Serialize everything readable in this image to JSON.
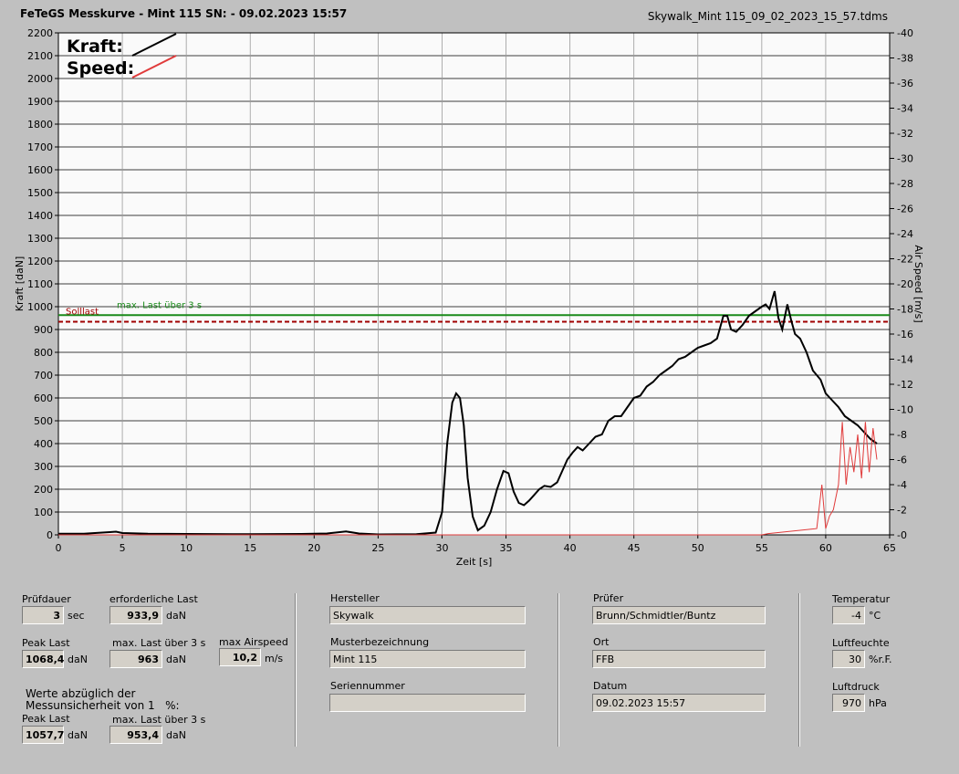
{
  "header": {
    "title": "FeTeGS Messkurve - Mint 115  SN:  - 09.02.2023 15:57",
    "file": "Skywalk_Mint 115_09_02_2023_15_57.tdms"
  },
  "chart_data": {
    "type": "line",
    "xlabel": "Zeit [s]",
    "ylabel": "Kraft [daN]",
    "y2label": "Air Speed [m/s]",
    "xlim": [
      0,
      65
    ],
    "ylim": [
      0,
      2200
    ],
    "y2lim": [
      0,
      40
    ],
    "xticks": [
      0,
      5,
      10,
      15,
      20,
      25,
      30,
      35,
      40,
      45,
      50,
      55,
      60,
      65
    ],
    "yticks": [
      0,
      100,
      200,
      300,
      400,
      500,
      600,
      700,
      800,
      900,
      1000,
      1100,
      1200,
      1300,
      1400,
      1500,
      1600,
      1700,
      1800,
      1900,
      2000,
      2100,
      2200
    ],
    "y2ticks": [
      0,
      2,
      4,
      6,
      8,
      10,
      12,
      14,
      16,
      18,
      20,
      22,
      24,
      26,
      28,
      30,
      32,
      34,
      36,
      38,
      40
    ],
    "grid": true,
    "legend": {
      "kraft": "Kraft:",
      "speed": "Speed:",
      "position": "top-left"
    },
    "reference_lines": [
      {
        "name": "max. Last über  3 s",
        "value": 963,
        "color": "#1a8a1a",
        "style": "solid"
      },
      {
        "name": "Solllast",
        "value": 933.9,
        "color": "#a00000",
        "style": "dashed"
      }
    ],
    "series": [
      {
        "name": "Kraft",
        "axis": "left",
        "color": "#000000",
        "x": [
          0,
          2,
          4,
          4.5,
          5,
          7,
          10,
          15,
          19,
          21,
          22.5,
          23.5,
          25,
          28,
          29.5,
          30,
          30.4,
          30.8,
          31.1,
          31.4,
          31.7,
          32,
          32.4,
          32.8,
          33.3,
          33.8,
          34.3,
          34.8,
          35.2,
          35.6,
          36,
          36.4,
          36.8,
          37.2,
          37.6,
          38,
          38.5,
          39,
          39.4,
          39.8,
          40.2,
          40.6,
          41,
          41.5,
          42,
          42.5,
          43,
          43.5,
          44,
          44.5,
          45,
          45.5,
          46,
          46.5,
          47,
          47.5,
          48,
          48.5,
          49,
          49.5,
          50,
          50.5,
          51,
          51.5,
          52,
          52.3,
          52.6,
          53,
          53.5,
          54,
          54.5,
          55,
          55.3,
          55.6,
          56,
          56.3,
          56.6,
          57,
          57.3,
          57.6,
          58,
          58.5,
          59,
          59.3,
          59.6,
          60,
          60.5,
          61,
          61.5,
          62,
          62.5,
          63,
          63.5,
          64
        ],
        "y": [
          5,
          5,
          12,
          14,
          8,
          5,
          4,
          3,
          4,
          6,
          15,
          6,
          2,
          3,
          10,
          100,
          400,
          580,
          620,
          600,
          480,
          250,
          80,
          20,
          40,
          100,
          200,
          280,
          270,
          190,
          140,
          130,
          150,
          175,
          200,
          215,
          210,
          230,
          280,
          330,
          360,
          385,
          370,
          400,
          430,
          440,
          500,
          520,
          520,
          560,
          600,
          610,
          650,
          670,
          700,
          720,
          740,
          770,
          780,
          800,
          820,
          830,
          840,
          860,
          960,
          960,
          900,
          890,
          920,
          960,
          980,
          1000,
          1010,
          990,
          1068,
          950,
          900,
          1010,
          940,
          880,
          860,
          800,
          720,
          700,
          680,
          620,
          590,
          560,
          520,
          500,
          480,
          450,
          420,
          400
        ]
      },
      {
        "name": "Speed",
        "axis": "right",
        "color": "#e03a3a",
        "x": [
          0,
          55,
          55.5,
          59.3,
          59.7,
          60,
          60.3,
          60.6,
          61,
          61.3,
          61.6,
          61.9,
          62.2,
          62.5,
          62.8,
          63.1,
          63.4,
          63.7,
          64
        ],
        "y": [
          0,
          0,
          0.1,
          0.5,
          4,
          0.5,
          1.5,
          2,
          4,
          9,
          4,
          7,
          5,
          8,
          4.5,
          9,
          5,
          8.5,
          6
        ]
      }
    ]
  },
  "panel": {
    "pruefdauer": {
      "label": "Prüfdauer",
      "value": "3",
      "unit": "sec"
    },
    "erforderliche_last": {
      "label": "erforderliche Last",
      "value": "933,9",
      "unit": "daN"
    },
    "peak_last": {
      "label": "Peak Last",
      "value": "1068,4",
      "unit": "daN"
    },
    "max_last_3s": {
      "label": "max. Last über  3 s",
      "value": "963",
      "unit": "daN"
    },
    "max_airspeed": {
      "label": "max Airspeed",
      "value": "10,2",
      "unit": "m/s"
    },
    "werte_note": "Werte abzüglich der\nMessunsicherheit von 1   %:",
    "peak_last_adj": {
      "label": "Peak Last",
      "value": "1057,7",
      "unit": "daN"
    },
    "max_last_3s_adj": {
      "label": "max. Last über  3 s",
      "value": "953,4",
      "unit": "daN"
    },
    "hersteller": {
      "label": "Hersteller",
      "value": "Skywalk"
    },
    "musterbezeichnung": {
      "label": "Musterbezeichnung",
      "value": "Mint 115"
    },
    "seriennummer": {
      "label": "Seriennummer",
      "value": ""
    },
    "pruefer": {
      "label": "Prüfer",
      "value": "Brunn/Schmidtler/Buntz"
    },
    "ort": {
      "label": "Ort",
      "value": "FFB"
    },
    "datum": {
      "label": "Datum",
      "value": "09.02.2023 15:57"
    },
    "temperatur": {
      "label": "Temperatur",
      "value": "-4",
      "unit": "°C"
    },
    "luftfeuchte": {
      "label": "Luftfeuchte",
      "value": "30",
      "unit": "%r.F."
    },
    "luftdruck": {
      "label": "Luftdruck",
      "value": "970",
      "unit": "hPa"
    }
  }
}
